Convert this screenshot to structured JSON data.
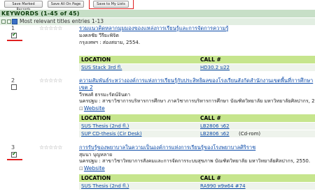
{
  "toolbar": {
    "save_marked": "Save Marked Records",
    "save_all": "Save All On Page",
    "save_lists": "Save to My Lists"
  },
  "header": {
    "title": "KEYWORDS (1-45 of 45)"
  },
  "sort": {
    "label": "Most relevant titles entries 1-13"
  },
  "holding_headers": {
    "location": "LOCATION",
    "call": "CALL #"
  },
  "records": [
    {
      "number": "1",
      "checked": true,
      "stars": "☆☆☆☆☆",
      "title": "รวมแนวคิดหลากมุมมองของแหล่งการเรียนรู้และการจัดการความรู้",
      "lines": [
        "มงคลชัย วีรียะพิจิต",
        "กรุงเทพฯ : ส่องสยาม, 2554."
      ],
      "holdings": [
        {
          "location": "SUS Stack 3rd fl.",
          "call": "HD30.2 ม22",
          "note": ""
        }
      ]
    },
    {
      "number": "2",
      "checked": false,
      "stars": "☆☆☆☆☆",
      "title": "ความสัมพันธ์ระหว่างองค์การแห่งการเรียนรู้กับประสิทธิผลของโรงเรียนสังกัดสำนักงานเขตพื้นที่การศึกษา เขต 2",
      "lines": [
        "วีรพงศ์ ธรรมะรัตน์จินดา",
        "นครปฐม : สาขาวิชาการบริหารการศึกษา ภาควิชาการบริหารการศึกษา บัณฑิตวิทยาลัย มหาวิทยาลัยศิลปากร, 2552"
      ],
      "website": "Website",
      "holdings": [
        {
          "location": "SUS Thesis (2nd fl.)",
          "call": "LB2806 ว62",
          "note": ""
        },
        {
          "location": "SUP CD-thesis (Cir Desk)",
          "call": "LB2806 ว62",
          "note": "(Cd-rom)"
        }
      ]
    },
    {
      "number": "3",
      "checked": true,
      "stars": "☆☆☆☆☆",
      "title": "การรับรู้ของพยาบาลในความเป็นองค์การแห่งการเรียนรู้ของโรงพยาบาลศิริราช",
      "lines": [
        "สุมนา บุญหลาย",
        "นครปฐม : สาขาวิชาวิทยาการสังคมและการจัดการระบบสุขภาพ บัณฑิตวิทยาลัย มหาวิทยาลัยศิลปากร, 2550."
      ],
      "website": "Website",
      "holdings": [
        {
          "location": "SUS Thesis (2nd fl.)",
          "call": "RA990 ท9ห64 #74",
          "note": ""
        }
      ]
    }
  ]
}
